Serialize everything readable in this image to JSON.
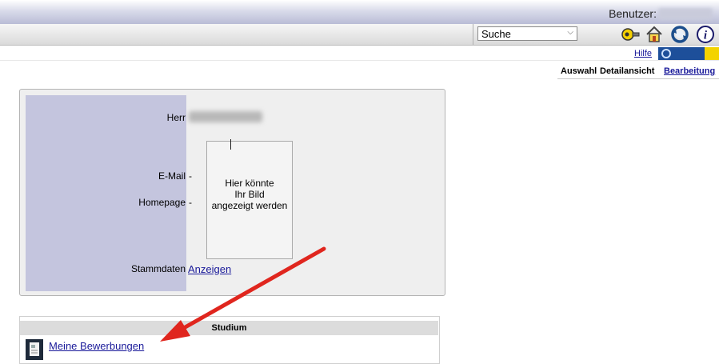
{
  "header": {
    "user_label": "Benutzer:"
  },
  "toolbar": {
    "search_select": "Suche",
    "icons": [
      "key-icon",
      "home-icon",
      "refresh-icon",
      "info-icon"
    ]
  },
  "nav": {
    "help_link": "Hilfe",
    "tabs": [
      "Auswahl",
      "Detailansicht",
      "Bearbeitung"
    ]
  },
  "person": {
    "salutation_label": "Herr",
    "email_label": "E-Mail",
    "email_value": "-",
    "homepage_label": "Homepage",
    "homepage_value": "-",
    "master_data_label": "Stammdaten",
    "master_data_link": "Anzeigen",
    "photo_placeholder_line1": "Hier könnte",
    "photo_placeholder_line2": "Ihr Bild",
    "photo_placeholder_line3": "angezeigt werden"
  },
  "study": {
    "header": "Studium",
    "link": "Meine Bewerbungen"
  },
  "colors": {
    "link": "#1a1a9a",
    "label_column": "#c4c5de",
    "arrow": "#e0261e"
  }
}
